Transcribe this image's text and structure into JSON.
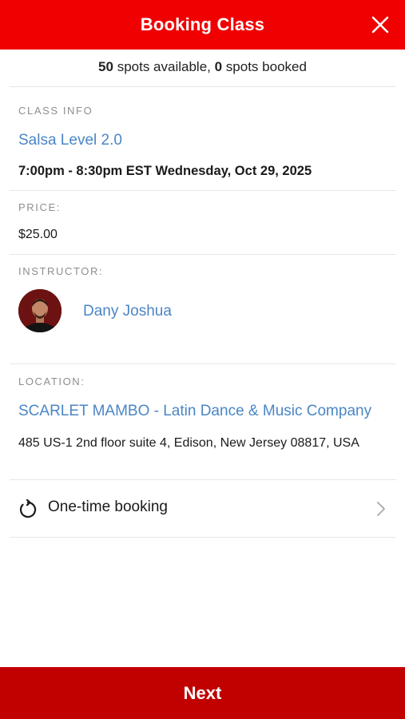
{
  "header": {
    "title": "Booking Class",
    "close_icon": "close-icon"
  },
  "spots": {
    "available_count": "50",
    "available_text": " spots available, ",
    "booked_count": "0",
    "booked_text": " spots booked"
  },
  "class_info": {
    "label": "CLASS INFO",
    "name": "Salsa Level 2.0",
    "schedule": "7:00pm - 8:30pm EST Wednesday, Oct 29, 2025"
  },
  "price": {
    "label": "PRICE:",
    "value": "$25.00"
  },
  "instructor": {
    "label": "INSTRUCTOR:",
    "name": "Dany Joshua"
  },
  "location": {
    "label": "LOCATION:",
    "name": "SCARLET MAMBO - Latin Dance & Music Company",
    "address": "485 US-1 2nd floor suite 4, Edison, New Jersey 08817, USA"
  },
  "booking_type": {
    "label": "One-time booking",
    "icon": "refresh-icon"
  },
  "footer": {
    "next_label": "Next"
  },
  "colors": {
    "header_red": "#f00000",
    "next_red": "#c10000",
    "link_blue": "#4a86c5",
    "label_gray": "#8e8e8e"
  }
}
